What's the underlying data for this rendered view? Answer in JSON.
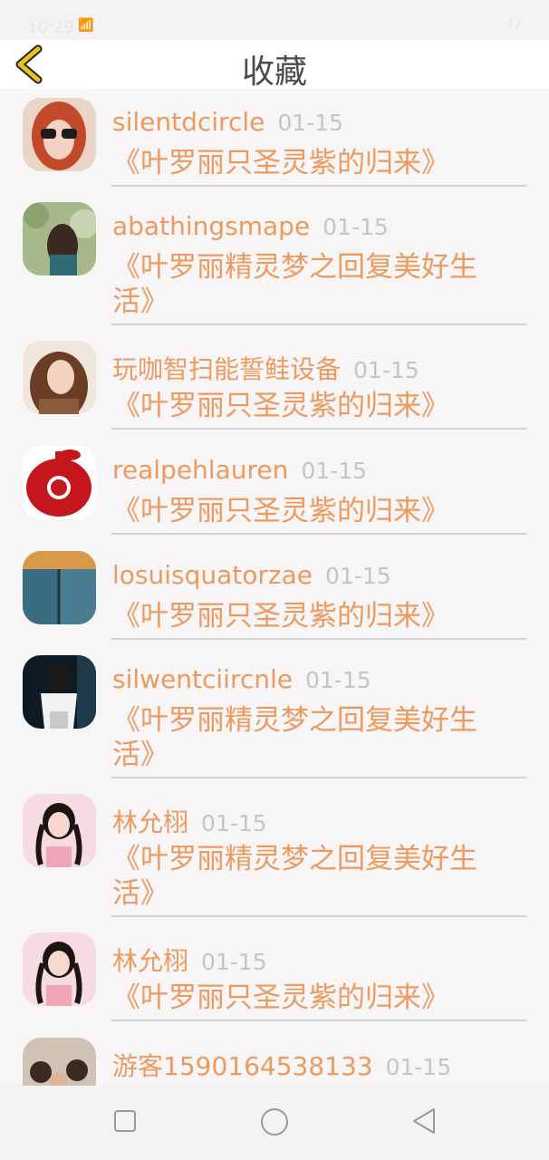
{
  "status_bar": {
    "time": "10:29",
    "signal": "📶",
    "battery": "47"
  },
  "header": {
    "title": "收藏"
  },
  "favorites": [
    {
      "user": "silentdcircle",
      "date": "01-15",
      "title": "《叶罗丽只圣灵紫的归来》"
    },
    {
      "user": "abathingsmape",
      "date": "01-15",
      "title": "《叶罗丽精灵梦之回复美好生活》"
    },
    {
      "user": "玩咖智扫能誓鲑设备",
      "date": "01-15",
      "title": "《叶罗丽只圣灵紫的归来》"
    },
    {
      "user": "realpehlauren",
      "date": "01-15",
      "title": "《叶罗丽只圣灵紫的归来》"
    },
    {
      "user": "losuisquatorzae",
      "date": "01-15",
      "title": "《叶罗丽只圣灵紫的归来》"
    },
    {
      "user": "silwentciircnle",
      "date": "01-15",
      "title": "《叶罗丽精灵梦之回复美好生活》"
    },
    {
      "user": "林允栩",
      "date": "01-15",
      "title": "《叶罗丽精灵梦之回复美好生活》"
    },
    {
      "user": "林允栩",
      "date": "01-15",
      "title": "《叶罗丽只圣灵紫的归来》"
    },
    {
      "user": "游客1590164538133",
      "date": "01-15",
      "title": ""
    }
  ],
  "nav": {
    "icons": [
      "square-icon",
      "circle-icon",
      "triangle-back-icon"
    ]
  },
  "colors": {
    "accent": "#ec9a5f",
    "date": "#c6c4c5",
    "back_arrow": "#e6c21f"
  }
}
